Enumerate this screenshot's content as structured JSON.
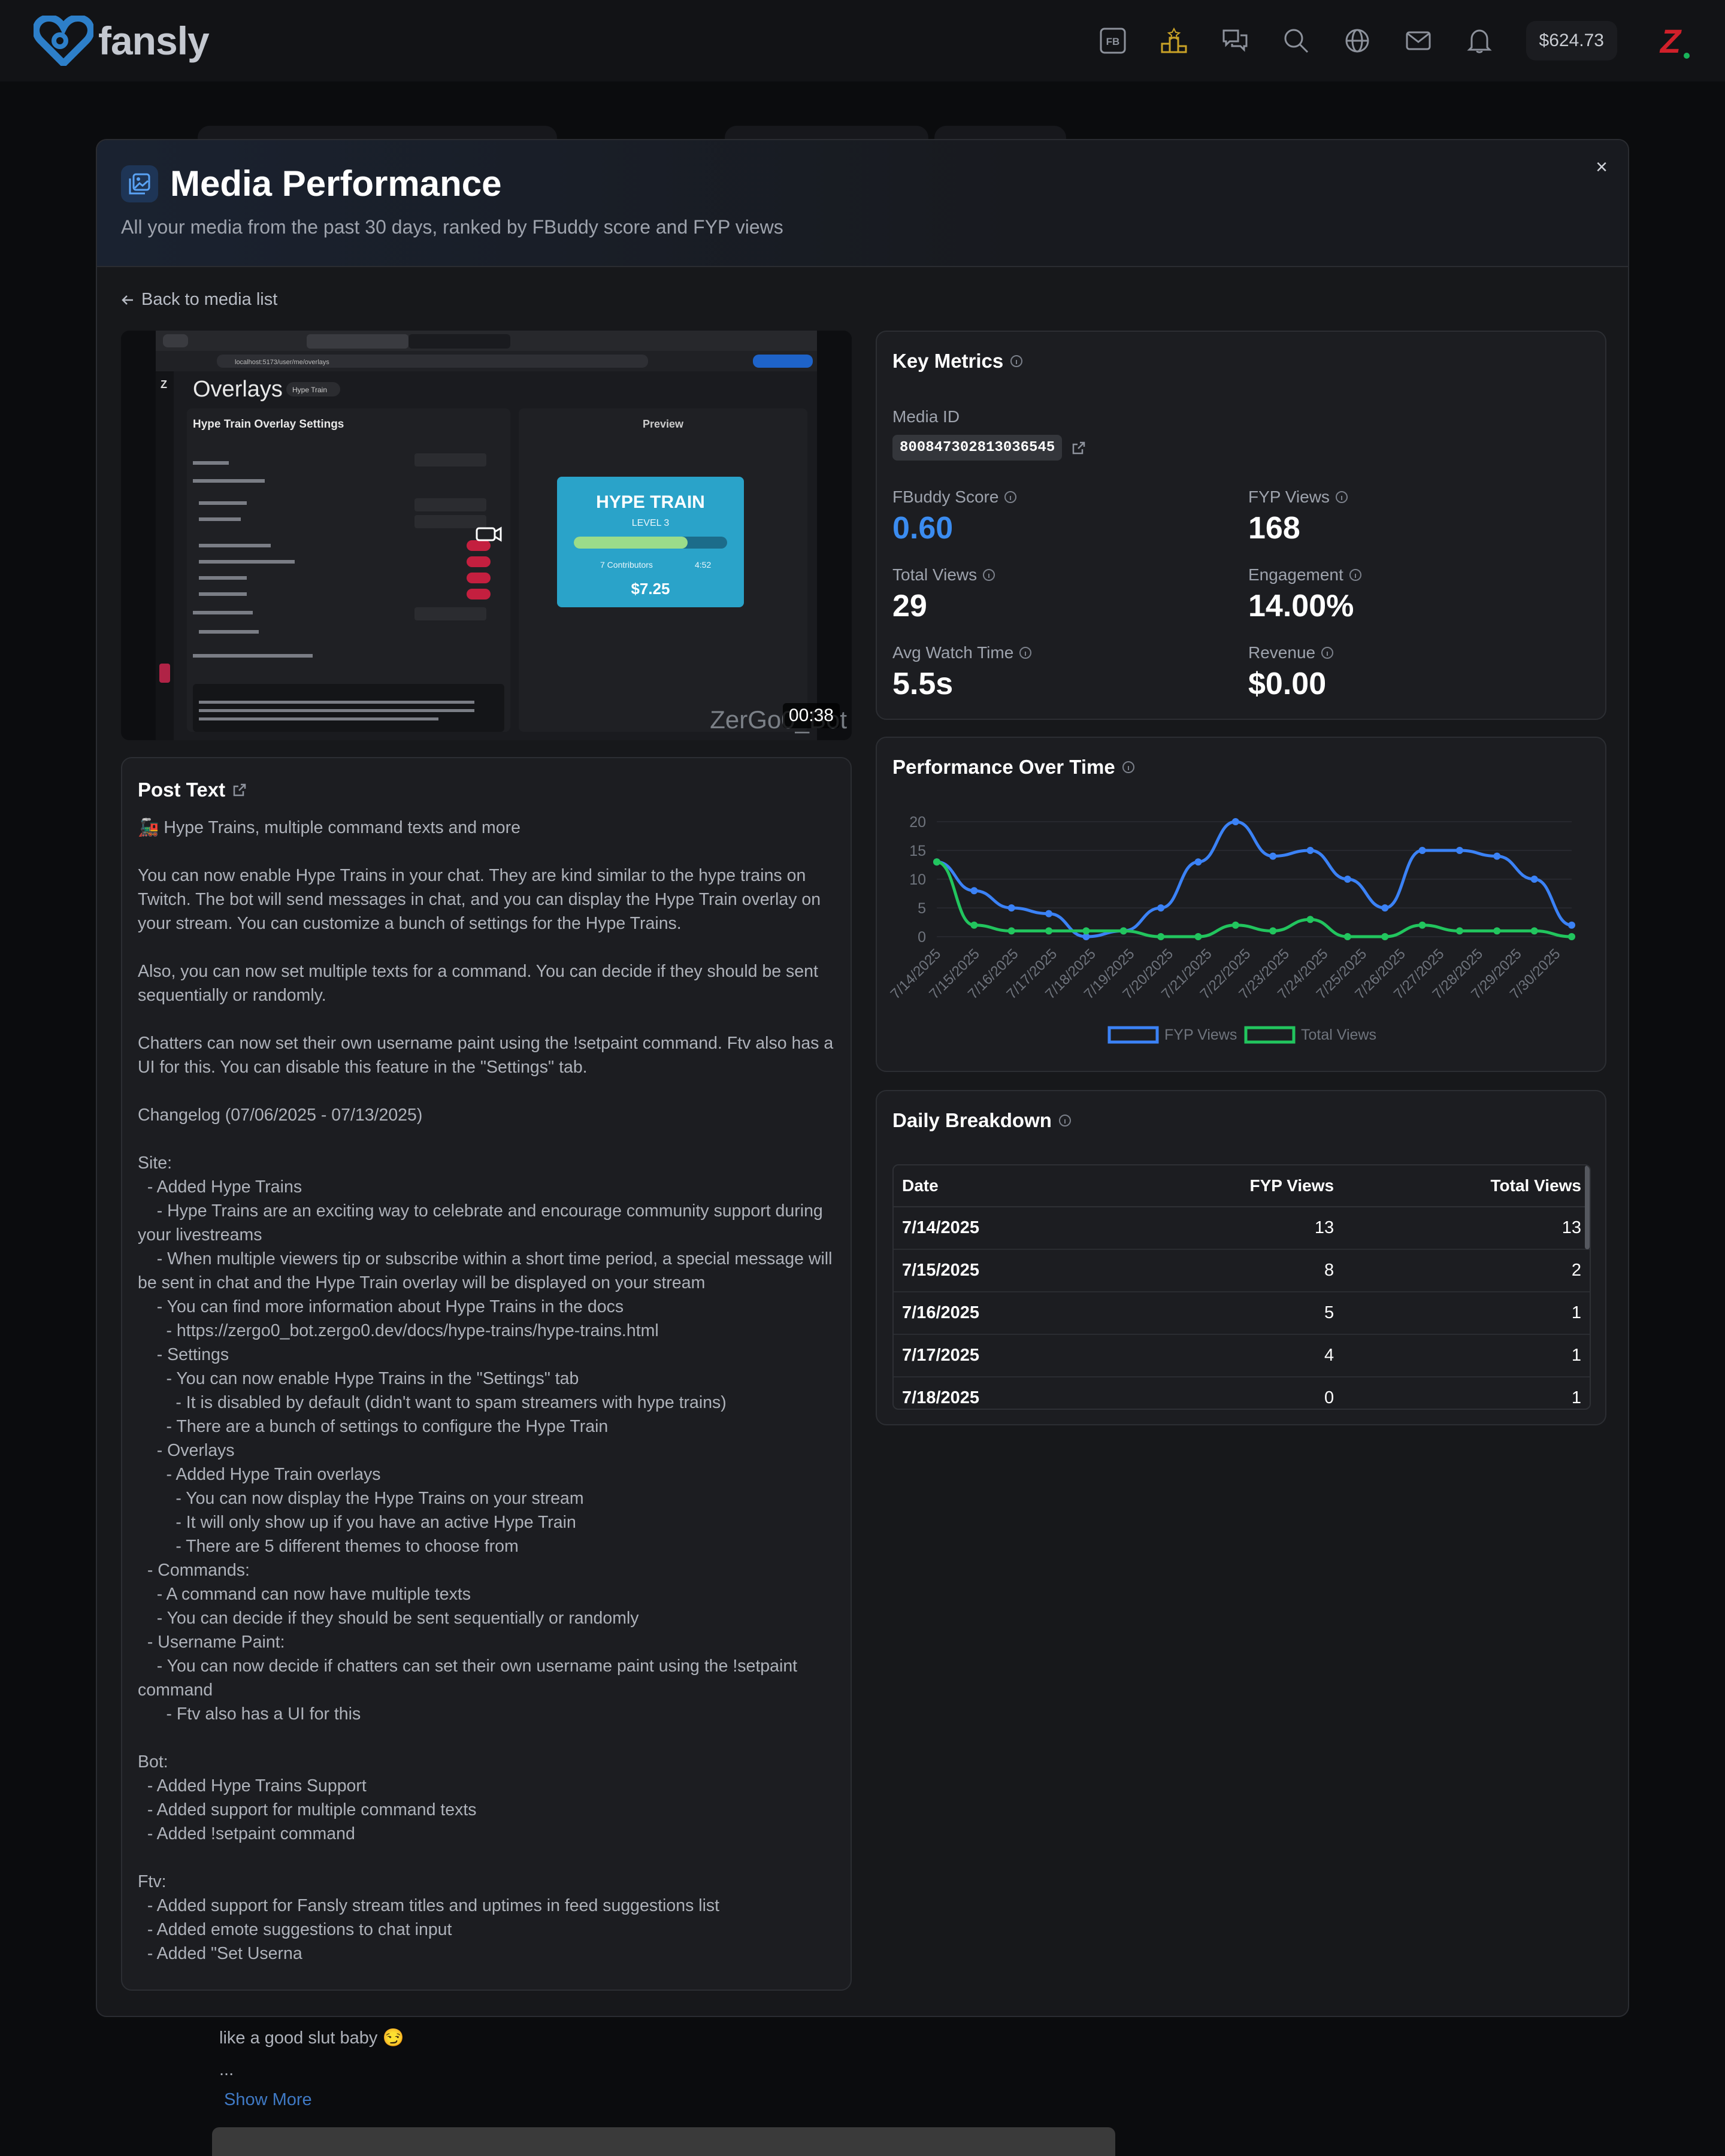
{
  "header": {
    "brand": "fansly",
    "fb_label": "FB",
    "balance": "$624.73",
    "avatar_letter": "Z",
    "icons": [
      "fb-badge-icon",
      "creator-rank-icon",
      "chat-icon",
      "search-icon",
      "globe-icon",
      "mail-icon",
      "bell-icon"
    ]
  },
  "modal": {
    "title": "Media Performance",
    "subtitle": "All your media from the past 30 days, ranked by FBuddy score and FYP views",
    "close": "×",
    "back_label": "Back to media list"
  },
  "video": {
    "duration": "00:38",
    "watermark": "ZerGo0_Bot",
    "screen_title": "Overlays",
    "screen_tag": "Hype Train",
    "settings_title": "Hype Train Overlay Settings",
    "preview_label": "Preview",
    "overlay_title": "HYPE TRAIN",
    "overlay_level": "LEVEL 3",
    "overlay_contributors": "7 Contributors",
    "overlay_timer": "4:52",
    "overlay_amount": "$7.25",
    "url_bar": "localhost:5173/user/me/overlays"
  },
  "post": {
    "title": "Post Text",
    "text": "🚂 Hype Trains, multiple command texts and more\n\nYou can now enable Hype Trains in your chat. They are kind similar to the hype trains on Twitch. The bot will send messages in chat, and you can display the Hype Train overlay on your stream. You can customize a bunch of settings for the Hype Trains.\n\nAlso, you can now set multiple texts for a command. You can decide if they should be sent sequentially or randomly.\n\nChatters can now set their own username paint using the !setpaint command. Ftv also has a UI for this. You can disable this feature in the \"Settings\" tab.\n\nChangelog (07/06/2025 - 07/13/2025)\n\nSite:\n  - Added Hype Trains\n    - Hype Trains are an exciting way to celebrate and encourage community support during your livestreams\n    - When multiple viewers tip or subscribe within a short time period, a special message will be sent in chat and the Hype Train overlay will be displayed on your stream\n    - You can find more information about Hype Trains in the docs\n      - https://zergo0_bot.zergo0.dev/docs/hype-trains/hype-trains.html\n    - Settings\n      - You can now enable Hype Trains in the \"Settings\" tab\n        - It is disabled by default (didn't want to spam streamers with hype trains)\n      - There are a bunch of settings to configure the Hype Train\n    - Overlays\n      - Added Hype Train overlays\n        - You can now display the Hype Trains on your stream\n        - It will only show up if you have an active Hype Train\n        - There are 5 different themes to choose from\n  - Commands:\n    - A command can now have multiple texts\n    - You can decide if they should be sent sequentially or randomly\n  - Username Paint:\n    - You can now decide if chatters can set their own username paint using the !setpaint command\n      - Ftv also has a UI for this\n\nBot:\n  - Added Hype Trains Support\n  - Added support for multiple command texts\n  - Added !setpaint command\n\nFtv:\n  - Added support for Fansly stream titles and uptimes in feed suggestions list\n  - Added emote suggestions to chat input\n  - Added \"Set Userna"
  },
  "metrics": {
    "title": "Key Metrics",
    "media_id_label": "Media ID",
    "media_id": "800847302813036545",
    "items": [
      {
        "label": "FBuddy Score",
        "value": "0.60",
        "accent": "#3b8cf0"
      },
      {
        "label": "FYP Views",
        "value": "168"
      },
      {
        "label": "Total Views",
        "value": "29"
      },
      {
        "label": "Engagement",
        "value": "14.00%"
      },
      {
        "label": "Avg Watch Time",
        "value": "5.5s"
      },
      {
        "label": "Revenue",
        "value": "$0.00"
      }
    ]
  },
  "chart_title": "Performance Over Time",
  "chart_data": {
    "type": "line",
    "categories": [
      "7/14/2025",
      "7/15/2025",
      "7/16/2025",
      "7/17/2025",
      "7/18/2025",
      "7/19/2025",
      "7/20/2025",
      "7/21/2025",
      "7/22/2025",
      "7/23/2025",
      "7/24/2025",
      "7/25/2025",
      "7/26/2025",
      "7/27/2025",
      "7/28/2025",
      "7/29/2025",
      "7/30/2025"
    ],
    "series": [
      {
        "name": "FYP Views",
        "color": "#3b82f6",
        "values": [
          13,
          8,
          5,
          4,
          0,
          1,
          5,
          13,
          20,
          14,
          15,
          10,
          5,
          15,
          15,
          14,
          10,
          2
        ]
      },
      {
        "name": "Total Views",
        "color": "#22c55e",
        "values": [
          13,
          2,
          1,
          1,
          1,
          1,
          0,
          0,
          2,
          1,
          3,
          0,
          0,
          2,
          1,
          1,
          1,
          0
        ]
      }
    ],
    "ylim": [
      0,
      20
    ],
    "yticks": [
      0,
      5,
      10,
      15,
      20
    ],
    "grid": true,
    "legend": "bottom"
  },
  "breakdown": {
    "title": "Daily Breakdown",
    "columns": [
      "Date",
      "FYP Views",
      "Total Views"
    ],
    "rows": [
      [
        "7/14/2025",
        "13",
        "13"
      ],
      [
        "7/15/2025",
        "8",
        "2"
      ],
      [
        "7/16/2025",
        "5",
        "1"
      ],
      [
        "7/17/2025",
        "4",
        "1"
      ],
      [
        "7/18/2025",
        "0",
        "1"
      ]
    ]
  },
  "feed": {
    "caption": "like a good slut baby 😏",
    "ellipsis": "...",
    "show_more": "Show More"
  }
}
